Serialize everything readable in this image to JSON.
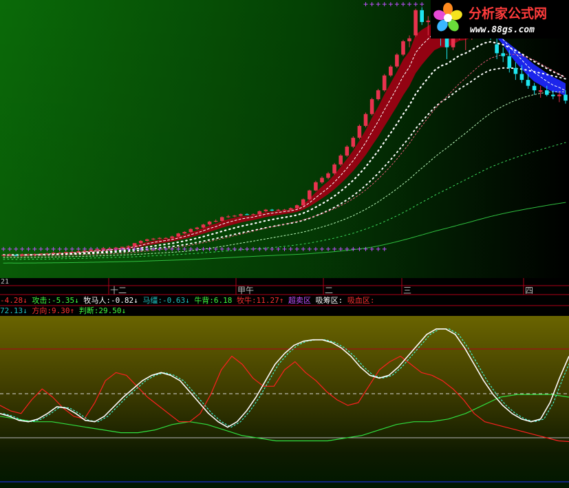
{
  "colors": {
    "up_candle": "#e8324e",
    "down_candle": "#1ee6f0",
    "ribbon_red": "#a00014",
    "ribbon_blue": "#1e28ff",
    "white_line": "#ffffff",
    "cyan_line": "#40ffe0",
    "red_line": "#ff2020",
    "green_line": "#30e040",
    "grid_red": "#b00018",
    "magenta_cross": "#c050ff"
  },
  "main_panel": {
    "left_value": "21",
    "time_ticks": [
      "十二",
      "甲午",
      "二",
      "三",
      "四"
    ]
  },
  "watermark": {
    "name": "分析家公式网",
    "url": "www.88gs.com",
    "icon": "flower-logo-icon"
  },
  "status_line1": [
    {
      "label": "",
      "value": "-4.28",
      "arrow": "↓",
      "color": "#ff3030"
    },
    {
      "label": "攻击:",
      "value": "-5.35",
      "arrow": "↓",
      "color": "#40ff40"
    },
    {
      "label": "牧马人:",
      "value": "-0.82",
      "arrow": "↓",
      "color": "#ffffff"
    },
    {
      "label": "马缰:",
      "value": "-0.63",
      "arrow": "↓",
      "color": "#20c0c0"
    },
    {
      "label": "牛背:",
      "value": "6.18",
      "arrow": "",
      "color": "#40ff40"
    },
    {
      "label": "牧牛:",
      "value": "11.27",
      "arrow": "↑",
      "color": "#ff3030"
    },
    {
      "label": "超卖区",
      "value": "",
      "arrow": "",
      "color": "#c050ff"
    },
    {
      "label": "吸筹区:",
      "value": "",
      "arrow": "",
      "color": "#ffffff"
    },
    {
      "label": "吸血区:",
      "value": "",
      "arrow": "",
      "color": "#ff3030"
    }
  ],
  "status_line2": [
    {
      "label": "",
      "value": "72.13",
      "arrow": "↓",
      "color": "#20c0c0"
    },
    {
      "label": "方向:",
      "value": "9.30",
      "arrow": "↑",
      "color": "#ff3030"
    },
    {
      "label": "判断:",
      "value": "29.50",
      "arrow": "↓",
      "color": "#40ff40"
    }
  ],
  "chart_data": {
    "type": "line",
    "title": "",
    "candles": [
      [
        10,
        10,
        10,
        10
      ],
      [
        10,
        11,
        9,
        10.5
      ],
      [
        10,
        10.5,
        9,
        9.5
      ],
      [
        9.5,
        11,
        9,
        10.5
      ],
      [
        10.5,
        11,
        10,
        10.5
      ],
      [
        10,
        11,
        9.5,
        10.5
      ],
      [
        10.5,
        11,
        10,
        11
      ],
      [
        11,
        11.5,
        10.5,
        11
      ],
      [
        11,
        12,
        10.5,
        11.5
      ],
      [
        11.5,
        12,
        11,
        11.5
      ],
      [
        11.5,
        12,
        11,
        12
      ],
      [
        12,
        12.5,
        11.5,
        12
      ],
      [
        12,
        13,
        11.5,
        12.5
      ],
      [
        12.5,
        13,
        12,
        13
      ],
      [
        13,
        14,
        12.5,
        13.5
      ],
      [
        13.5,
        14,
        13,
        14
      ],
      [
        14,
        15,
        13.5,
        14.5
      ],
      [
        14.5,
        15,
        14,
        14.5
      ],
      [
        14.5,
        15,
        14,
        15
      ],
      [
        15,
        15.5,
        14.5,
        15.5
      ],
      [
        15.5,
        16.5,
        15,
        16
      ],
      [
        16,
        18,
        15.5,
        18
      ],
      [
        18,
        20,
        17.5,
        19.5
      ],
      [
        19.5,
        21,
        19,
        20.5
      ],
      [
        20.5,
        21.5,
        20,
        21
      ],
      [
        21,
        22,
        20.5,
        21.5
      ],
      [
        21.5,
        22,
        21,
        21.5
      ],
      [
        21.5,
        23,
        21,
        22.5
      ],
      [
        22.5,
        25,
        22,
        24.5
      ],
      [
        24.5,
        26,
        24,
        25.5
      ],
      [
        25.5,
        28,
        25,
        27.5
      ],
      [
        27.5,
        29,
        27,
        28.5
      ],
      [
        28.5,
        31,
        28,
        30.5
      ],
      [
        30.5,
        33,
        30,
        32.5
      ],
      [
        32.5,
        34,
        32,
        33
      ],
      [
        33,
        36,
        32.5,
        35.5
      ],
      [
        35.5,
        37,
        35,
        36
      ],
      [
        36,
        37,
        35.5,
        36.5
      ],
      [
        36.5,
        38,
        36,
        37.5
      ],
      [
        37.5,
        38,
        37,
        37
      ],
      [
        37,
        38,
        36.5,
        37.5
      ],
      [
        37.5,
        40,
        37,
        39.5
      ],
      [
        39.5,
        41,
        39,
        40.5
      ],
      [
        40.5,
        41,
        39.5,
        40
      ],
      [
        40,
        41,
        39.5,
        40.5
      ],
      [
        40.5,
        41,
        40,
        40.5
      ],
      [
        40.5,
        42,
        40,
        41.5
      ],
      [
        41.5,
        44,
        41,
        43.5
      ],
      [
        43.5,
        48,
        43,
        47.5
      ],
      [
        47.5,
        54,
        47,
        53.5
      ],
      [
        53.5,
        60,
        53,
        59
      ],
      [
        59,
        63,
        58,
        62
      ],
      [
        62,
        66,
        61,
        65
      ],
      [
        65,
        72,
        64,
        71
      ],
      [
        71,
        78,
        70,
        77
      ],
      [
        77,
        84,
        76,
        83
      ],
      [
        83,
        90,
        82,
        89
      ],
      [
        89,
        98,
        88,
        97
      ],
      [
        97,
        106,
        96,
        105
      ],
      [
        105,
        116,
        104,
        115
      ],
      [
        115,
        122,
        114,
        121
      ],
      [
        121,
        132,
        120,
        131
      ],
      [
        131,
        138,
        130,
        137
      ],
      [
        137,
        146,
        136,
        145
      ],
      [
        145,
        155,
        144,
        154
      ],
      [
        154,
        158,
        150,
        156
      ],
      [
        158,
        176,
        157,
        175
      ],
      [
        175,
        177,
        165,
        167
      ],
      [
        167,
        171,
        158,
        168
      ],
      [
        168,
        175,
        160,
        172
      ],
      [
        165,
        170,
        151,
        160
      ],
      [
        160,
        165,
        142,
        150
      ],
      [
        150,
        165,
        148,
        162
      ],
      [
        162,
        170,
        155,
        166
      ],
      [
        158,
        162,
        148,
        158
      ],
      [
        163,
        168,
        155,
        165
      ],
      [
        165,
        172,
        160,
        170
      ],
      [
        170,
        174,
        164,
        168
      ],
      [
        168,
        170,
        155,
        160
      ],
      [
        152,
        157,
        142,
        146
      ],
      [
        146,
        150,
        140,
        144
      ],
      [
        144,
        148,
        133,
        136
      ],
      [
        136,
        140,
        128,
        132
      ],
      [
        132,
        138,
        126,
        128
      ],
      [
        128,
        132,
        122,
        124
      ],
      [
        124,
        126,
        118,
        121
      ],
      [
        120,
        124,
        116,
        121
      ],
      [
        121,
        124,
        117,
        118
      ],
      [
        118,
        121,
        115,
        117
      ],
      [
        117,
        120,
        113,
        118
      ],
      [
        118,
        121,
        112,
        114
      ]
    ],
    "oscillator": {
      "white": [
        50,
        48,
        45,
        44,
        46,
        50,
        55,
        54,
        50,
        45,
        44,
        48,
        55,
        62,
        68,
        74,
        78,
        80,
        78,
        74,
        66,
        58,
        50,
        44,
        40,
        44,
        52,
        62,
        74,
        86,
        94,
        100,
        103,
        104,
        104,
        102,
        98,
        92,
        84,
        78,
        76,
        78,
        84,
        92,
        100,
        108,
        112,
        112,
        108,
        98,
        86,
        74,
        64,
        56,
        50,
        46,
        44,
        46,
        58,
        76,
        92
      ],
      "red": [
        56,
        52,
        50,
        60,
        68,
        62,
        54,
        48,
        46,
        58,
        74,
        80,
        78,
        70,
        62,
        56,
        50,
        44,
        44,
        50,
        64,
        82,
        92,
        86,
        76,
        70,
        70,
        82,
        88,
        80,
        74,
        66,
        60,
        56,
        58,
        70,
        82,
        88,
        92,
        86,
        80,
        78,
        74,
        68,
        60,
        50,
        44,
        42,
        40,
        38,
        36,
        34,
        32,
        30,
        29.5
      ],
      "green": [
        48,
        46,
        44,
        44,
        42,
        40,
        38,
        36,
        36,
        38,
        42,
        44,
        42,
        38,
        34,
        32,
        30,
        30,
        30,
        30,
        32,
        34,
        38,
        42,
        44,
        44,
        46,
        50,
        56,
        62,
        64,
        64,
        64,
        62
      ],
      "ylim": [
        0,
        120
      ]
    }
  }
}
